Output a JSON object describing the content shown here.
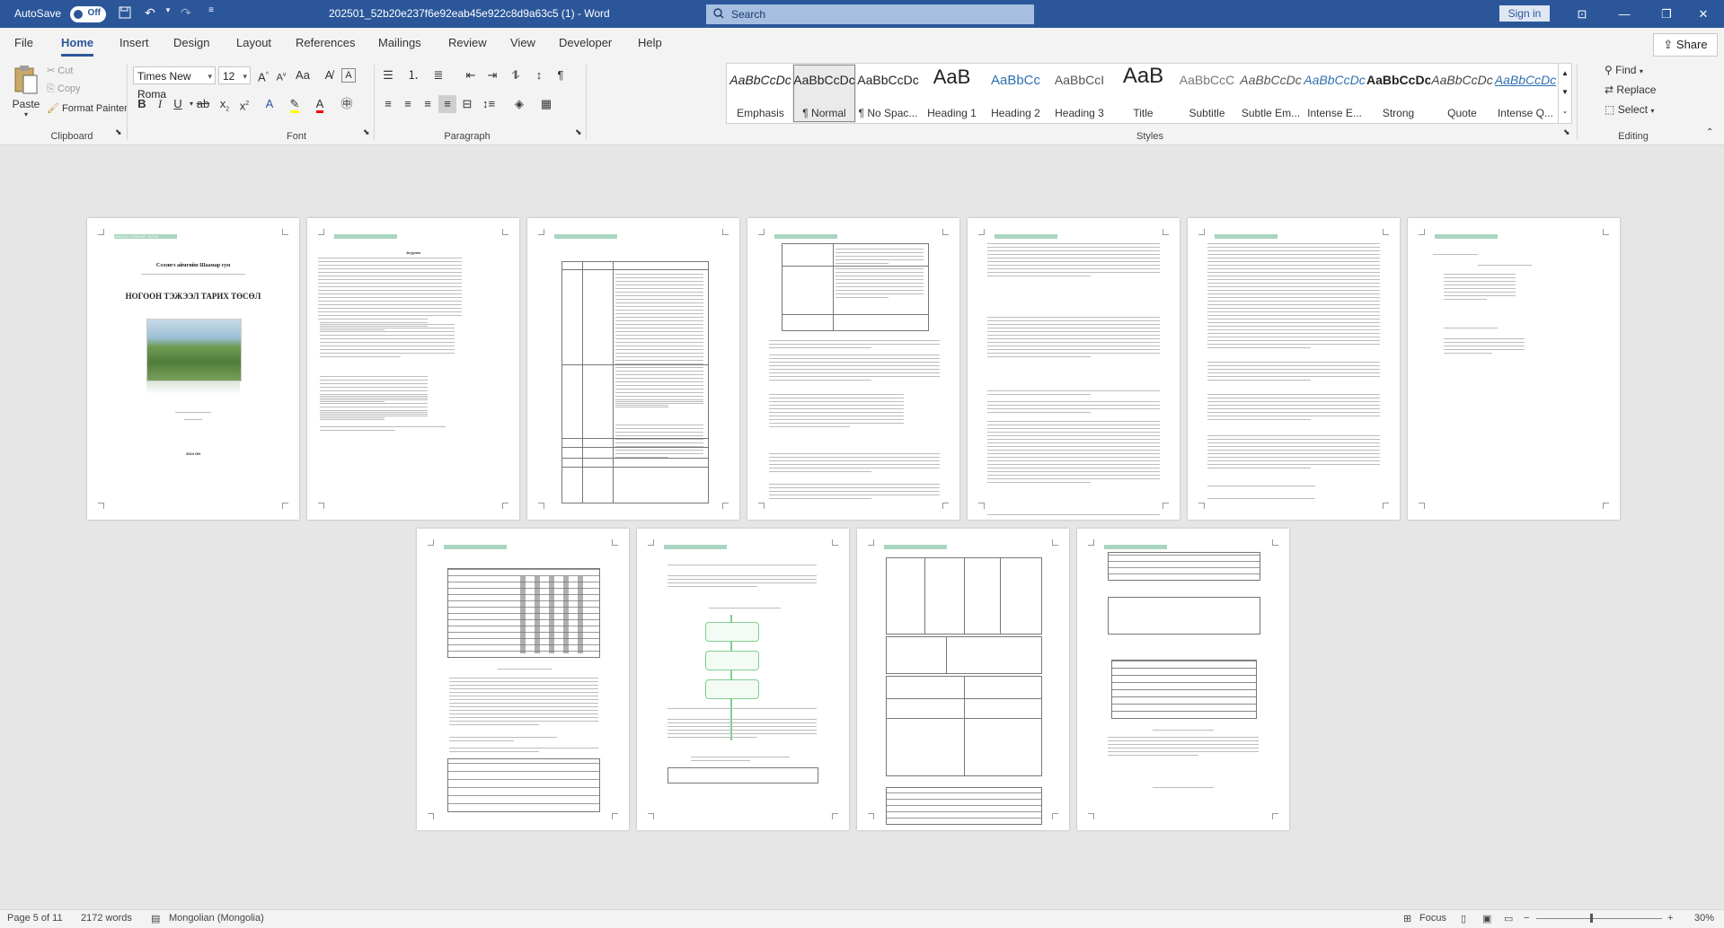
{
  "titlebar": {
    "autosave_label": "AutoSave",
    "autosave_state": "Off",
    "document_title": "202501_52b20e237f6e92eab45e922c8d9a63c5 (1)  -  Word",
    "search_placeholder": "Search",
    "signin_label": "Sign in"
  },
  "tabs": [
    {
      "label": "File"
    },
    {
      "label": "Home"
    },
    {
      "label": "Insert"
    },
    {
      "label": "Design"
    },
    {
      "label": "Layout"
    },
    {
      "label": "References"
    },
    {
      "label": "Mailings"
    },
    {
      "label": "Review"
    },
    {
      "label": "View"
    },
    {
      "label": "Developer"
    },
    {
      "label": "Help"
    }
  ],
  "share_label": "Share",
  "clipboard": {
    "paste": "Paste",
    "cut": "Cut",
    "copy": "Copy",
    "format_painter": "Format Painter",
    "group": "Clipboard"
  },
  "font": {
    "family": "Times New Roma",
    "size": "12",
    "group": "Font"
  },
  "paragraph": {
    "group": "Paragraph"
  },
  "styles": {
    "group": "Styles",
    "items": [
      {
        "preview": "AaBbCcDc",
        "name": "Emphasis"
      },
      {
        "preview": "AaBbCcDc",
        "name": "¶ Normal"
      },
      {
        "preview": "AaBbCcDc",
        "name": "¶ No Spac..."
      },
      {
        "preview": "AaB",
        "name": "Heading 1"
      },
      {
        "preview": "AaBbCc",
        "name": "Heading 2"
      },
      {
        "preview": "AaBbCcI",
        "name": "Heading 3"
      },
      {
        "preview": "AaB",
        "name": "Title"
      },
      {
        "preview": "AaBbCcC",
        "name": "Subtitle"
      },
      {
        "preview": "AaBbCcDc",
        "name": "Subtle Em..."
      },
      {
        "preview": "AaBbCcDc",
        "name": "Intense E..."
      },
      {
        "preview": "AaBbCcDc",
        "name": "Strong"
      },
      {
        "preview": "AaBbCcDc",
        "name": "Quote"
      },
      {
        "preview": "AaBbCcDc",
        "name": "Intense Q..."
      }
    ]
  },
  "editing": {
    "find": "Find",
    "replace": "Replace",
    "select": "Select",
    "group": "Editing"
  },
  "document": {
    "cover_title": "НОГООН ТЭЖЭЭЛ ТАРИХ ТӨСӨЛ",
    "cover_subtitle": "Сэлэнгэ аймгийн Шаамар сум",
    "cover_year": "2024 ОН",
    "header_tag": "НОГООН ТЭЖЭЭЛ ТАРИХ",
    "contents_title": "Агуулга"
  },
  "status": {
    "page": "Page 5 of 11",
    "words": "2172 words",
    "language": "Mongolian (Mongolia)",
    "focus": "Focus",
    "zoom": "30%"
  }
}
